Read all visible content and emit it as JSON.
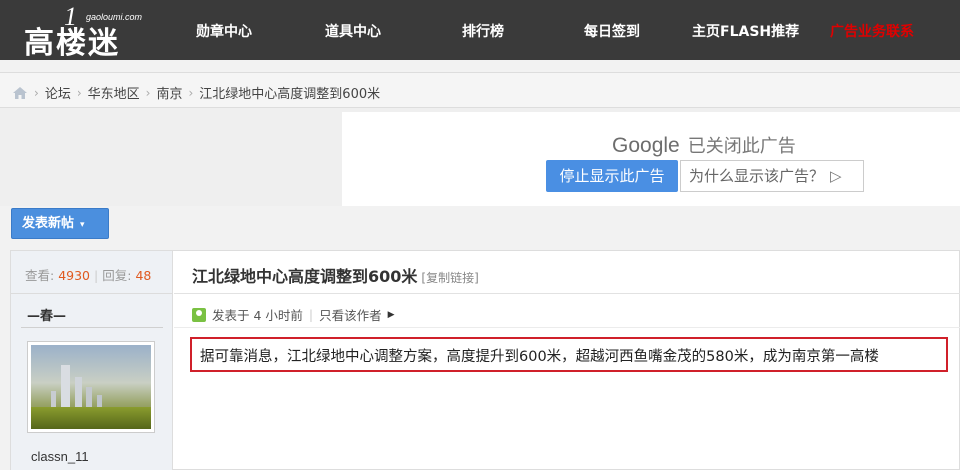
{
  "header": {
    "logo_text": "高楼迷",
    "logo_sub": "gaoloumi.com",
    "nav": [
      {
        "label": "勋章中心"
      },
      {
        "label": "道具中心"
      },
      {
        "label": "排行榜"
      },
      {
        "label": "每日签到"
      },
      {
        "label": "主页FLASH推荐"
      },
      {
        "label": "广告业务联系"
      }
    ]
  },
  "breadcrumb": {
    "items": [
      "论坛",
      "华东地区",
      "南京",
      "江北绿地中心高度调整到600米"
    ],
    "separator": "›"
  },
  "ad": {
    "google": "Google",
    "closed_text": "已关闭此广告",
    "stop_button": "停止显示此广告",
    "why_button": "为什么显示该广告？"
  },
  "toolbar": {
    "new_post_label": "发表新帖",
    "new_post_caret": "▾"
  },
  "thread": {
    "views_label": "查看:",
    "views": "4930",
    "replies_label": "回复:",
    "replies": "48",
    "title": "江北绿地中心高度调整到600米",
    "copy_link": "[复制链接]",
    "author": "—春—",
    "username": "classn_11",
    "posted": "发表于 4 小时前",
    "only_author": "只看该作者",
    "content": "据可靠消息，江北绿地中心调整方案，高度提升到600米，超越河西鱼嘴金茂的580米，成为南京第一高楼"
  },
  "colors": {
    "topbar": "#3a3a3a",
    "accent_blue": "#4a8fe3",
    "highlight_red": "#d0202a",
    "number_orange": "#e05a20"
  }
}
